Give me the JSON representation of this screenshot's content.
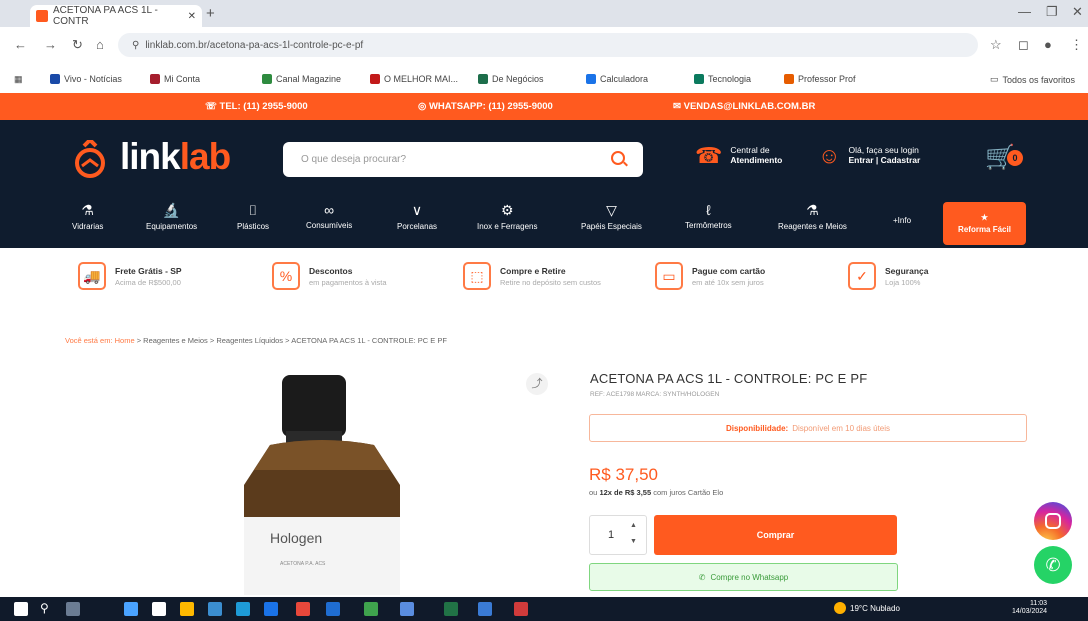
{
  "browser": {
    "tab_title": "ACETONA PA ACS 1L - CONTR",
    "url": "linklab.com.br/acetona-pa-acs-1l-controle-pc-e-pf",
    "bookmarks": [
      "Vivo - Notícias",
      "Mi Conta",
      "Canal Magazine",
      "O MELHOR MAI...",
      "De Negócios",
      "Calculadora",
      "Tecnologia",
      "Professor Prof"
    ],
    "bookmarks_right": "Todos os favoritos"
  },
  "topbar": {
    "phone": "TEL: (11) 2955-9000",
    "whatsapp": "WHATSAPP: (11) 2955-9000",
    "email": "VENDAS@LINKLAB.COM.BR"
  },
  "header": {
    "logo_text_link": "link",
    "logo_text_lab": "lab",
    "search_placeholder": "O que deseja procurar?",
    "central": {
      "line1": "Central de",
      "line2": "Atendimento"
    },
    "account": {
      "line1": "Olá, faça seu login",
      "line2": "Entrar | Cadastrar"
    },
    "cart_count": "0"
  },
  "categories": [
    {
      "icon": "flask-icon",
      "glyph": "⚗",
      "label": "Vidrarias"
    },
    {
      "icon": "microscope-icon",
      "glyph": "🔬",
      "label": "Equipamentos"
    },
    {
      "icon": "beaker-icon",
      "glyph": "⌷",
      "label": "Plásticos"
    },
    {
      "icon": "consumables-icon",
      "glyph": "∞",
      "label": "Consumíveis"
    },
    {
      "icon": "funnel-icon",
      "glyph": "∨",
      "label": "Porcelanas"
    },
    {
      "icon": "tools-icon",
      "glyph": "⚙",
      "label": "Inox e Ferragens"
    },
    {
      "icon": "filter-icon",
      "glyph": "▽",
      "label": "Papéis Especiais"
    },
    {
      "icon": "thermometer-icon",
      "glyph": "ℓ",
      "label": "Termômetros"
    },
    {
      "icon": "reagent-icon",
      "glyph": "⚗",
      "label": "Reagentes e Meios"
    },
    {
      "icon": "more-icon",
      "glyph": "",
      "label": "+Info"
    }
  ],
  "category_highlight": {
    "label": "Reforma Fácil",
    "glyph": "★"
  },
  "benefits": [
    {
      "title": "Frete Grátis - SP",
      "subtitle": "Acima de R$500,00",
      "glyph": "🚚"
    },
    {
      "title": "Descontos",
      "subtitle": "em pagamentos à vista",
      "glyph": "%"
    },
    {
      "title": "Compre e Retire",
      "subtitle": "Retire no depósito sem custos",
      "glyph": "⬚"
    },
    {
      "title": "Pague com cartão",
      "subtitle": "em até 10x sem juros",
      "glyph": "▭"
    },
    {
      "title": "Segurança",
      "subtitle": "Loja 100%",
      "glyph": "✓"
    }
  ],
  "breadcrumb": {
    "home": "Você está em: Home",
    "rest": " > Reagentes e Meios > Reagentes Líquidos > ACETONA PA ACS 1L - CONTROLE: PC E PF"
  },
  "product": {
    "title": "ACETONA PA ACS 1L - CONTROLE: PC E PF",
    "meta": "REF: ACE1798   MARCA: SYNTH/HOLOGEN",
    "availability_label": "Disponibilidade:",
    "availability_text": "Disponível em 10 dias úteis",
    "price": "R$ 37,50",
    "installments_prefix": "ou",
    "installments_bold": "12x de R$ 3,55",
    "installments_suffix": "com juros Cartão Elo",
    "quantity": "1",
    "buy_label": "Comprar",
    "whatsapp_label": "Compre no Whatsapp",
    "bottle_brand": "Hologen",
    "bottle_sublabel": "ACETONA P.A. ACS"
  },
  "taskbar": {
    "weather": "19°C Nublado",
    "time": "11:03",
    "date": "14/03/2024"
  },
  "colors": {
    "accent": "#ff5a1f",
    "header_bg": "#0f1c2e",
    "whatsapp": "#25d366"
  }
}
